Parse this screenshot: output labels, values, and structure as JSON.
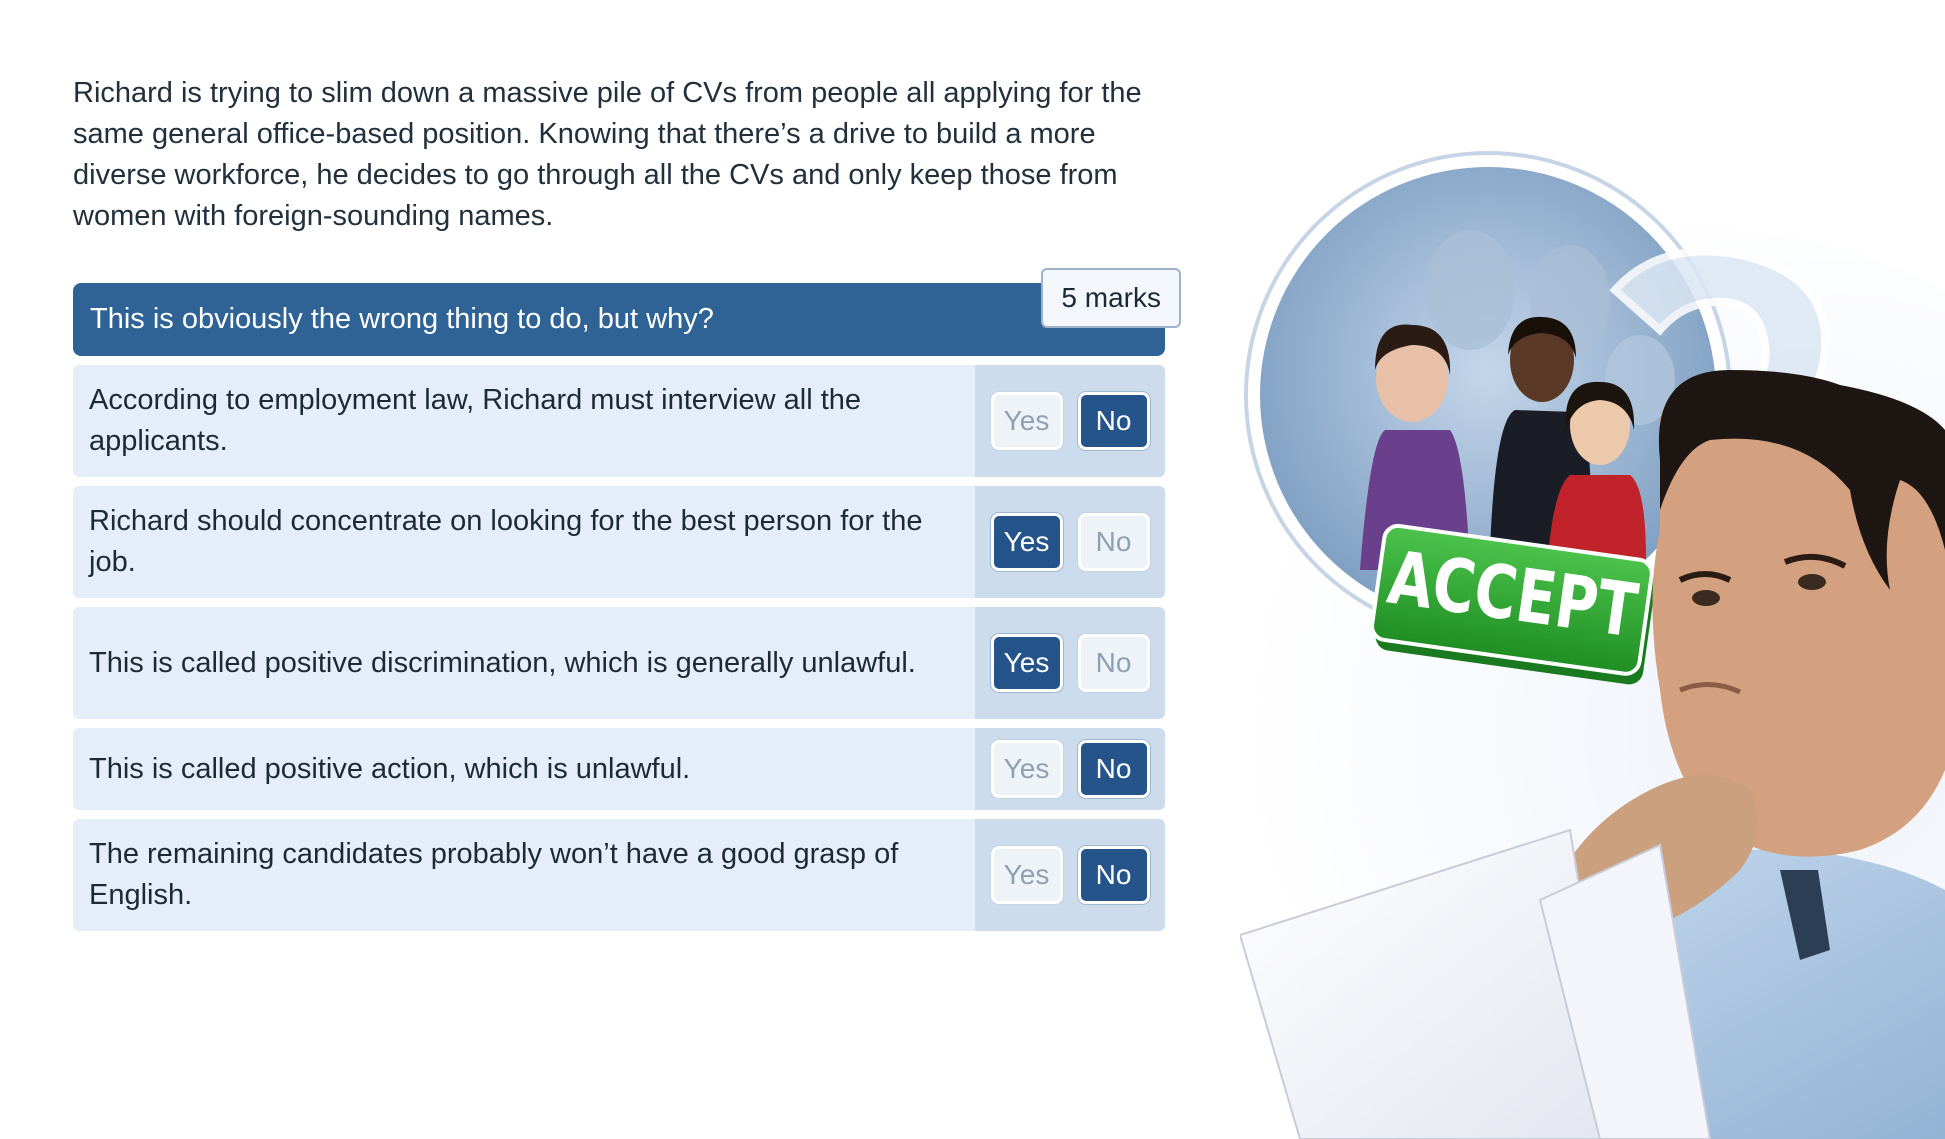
{
  "scenario": {
    "text": "Richard is trying to slim down a massive pile of CVs from people all applying for the same general office-based position. Knowing that there’s a drive to build a more diverse workforce, he decides to go through all the CVs and only keep those from women with foreign-sounding names."
  },
  "question": {
    "prompt": "This is obviously the wrong thing to do, but why?",
    "marks": "5 marks"
  },
  "statements": [
    {
      "text": "According to employment law, Richard must interview all the applicants.",
      "selected": "No"
    },
    {
      "text": "Richard should concentrate on looking for the best person for the job.",
      "selected": "Yes"
    },
    {
      "text": "This is called positive discrimination, which is generally unlawful.",
      "selected": "Yes"
    },
    {
      "text": "This is called positive action, which is unlawful.",
      "selected": "No"
    },
    {
      "text": "The remaining candidates probably won’t have a good grasp of English.",
      "selected": "No"
    }
  ],
  "buttons": {
    "yes_label": "Yes",
    "no_label": "No"
  },
  "illustration": {
    "sign_text": "ACCEPT"
  },
  "colors": {
    "accent": "#2f6395",
    "selected_button": "#24548a",
    "row_bg": "#e5eef8",
    "sign_green": "#2fa52f"
  }
}
